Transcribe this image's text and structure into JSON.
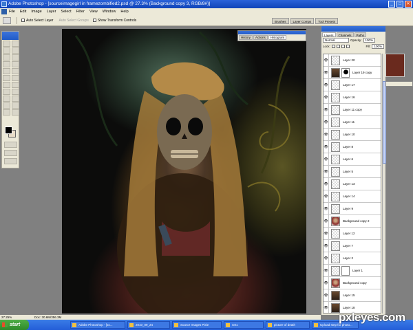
{
  "window": {
    "title": "Adobe Photoshop - [sourceimagegirl in framezombified2.psd @ 27.3% (Background copy 3, RGB/8#)]",
    "minimize": "_",
    "maximize": "□",
    "close": "✕"
  },
  "menu": [
    "File",
    "Edit",
    "Image",
    "Layer",
    "Select",
    "Filter",
    "View",
    "Window",
    "Help"
  ],
  "options": {
    "auto_select_layer": "Auto Select Layer",
    "auto_select_groups": "Auto Select Groups",
    "show_transform_controls": "Show Transform Controls"
  },
  "dock_tabs": [
    "Brushes",
    "Layer Comps",
    "Tool Presets"
  ],
  "nav_panel_tabs": [
    "History",
    "Actions",
    "Histogram"
  ],
  "layers_panel": {
    "tabs": [
      "Layers",
      "Channels",
      "Paths"
    ],
    "blend_mode": "Normal",
    "opacity_label": "Opacity:",
    "opacity_value": "100%",
    "lock_label": "Lock:",
    "fill_label": "Fill:",
    "fill_value": "100%",
    "layers": [
      {
        "name": "Layer 20",
        "thumb": "trans",
        "mask": false,
        "selected": false
      },
      {
        "name": "Layer 19 copy",
        "thumb": "img",
        "mask": true,
        "selected": false
      },
      {
        "name": "Layer 17",
        "thumb": "trans",
        "mask": false,
        "selected": false
      },
      {
        "name": "Layer 16",
        "thumb": "trans",
        "mask": false,
        "selected": false
      },
      {
        "name": "Layer 11 copy",
        "thumb": "trans",
        "mask": false,
        "selected": false
      },
      {
        "name": "Layer 11",
        "thumb": "trans",
        "mask": false,
        "selected": false
      },
      {
        "name": "Layer 10",
        "thumb": "trans",
        "mask": false,
        "selected": false
      },
      {
        "name": "Layer 8",
        "thumb": "trans",
        "mask": false,
        "selected": false
      },
      {
        "name": "Layer 6",
        "thumb": "trans",
        "mask": false,
        "selected": false
      },
      {
        "name": "Layer 5",
        "thumb": "trans",
        "mask": false,
        "selected": false
      },
      {
        "name": "Layer 13",
        "thumb": "trans",
        "mask": false,
        "selected": false
      },
      {
        "name": "Layer 14",
        "thumb": "trans",
        "mask": false,
        "selected": false
      },
      {
        "name": "Layer 9",
        "thumb": "trans",
        "mask": false,
        "selected": false
      },
      {
        "name": "Background copy 2",
        "thumb": "pink",
        "mask": false,
        "selected": false
      },
      {
        "name": "Layer 12",
        "thumb": "trans",
        "mask": false,
        "selected": false
      },
      {
        "name": "Layer 7",
        "thumb": "trans",
        "mask": false,
        "selected": false
      },
      {
        "name": "Layer 2",
        "thumb": "trans",
        "mask": false,
        "selected": false
      },
      {
        "name": "Layer 1",
        "thumb": "trans",
        "mask": true,
        "selected": false
      },
      {
        "name": "Background copy",
        "thumb": "pink",
        "mask": false,
        "selected": false
      },
      {
        "name": "Layer 15",
        "thumb": "img",
        "mask": false,
        "selected": false
      },
      {
        "name": "Layer 18",
        "thumb": "img",
        "mask": false,
        "selected": false
      }
    ]
  },
  "status": {
    "zoom": "27.25%",
    "doc": "Doc: 30.6M/356.3M"
  },
  "taskbar": {
    "start": "start",
    "items": [
      "Adobe Photoshop - [so...",
      "2010_09_24",
      "Source Images Pixle",
      "set1",
      "picture of death",
      "Upload step for photo..."
    ]
  },
  "watermark": "pxleyes.com",
  "colors": {
    "xp_blue": "#245ed8",
    "xp_green": "#2f8a2a",
    "panel_bg": "#ece9d8"
  }
}
